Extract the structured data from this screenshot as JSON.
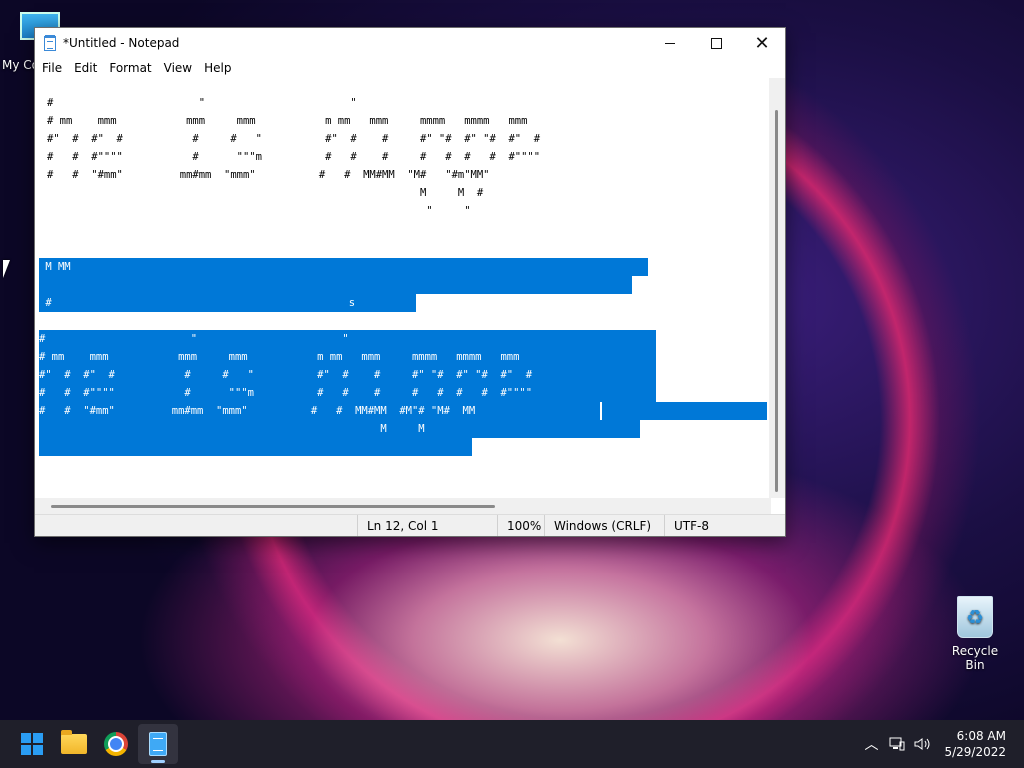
{
  "desktop": {
    "icons": [
      {
        "label": "My Co"
      },
      {
        "label": "Recycle Bin"
      }
    ]
  },
  "window": {
    "title": "*Untitled - Notepad",
    "menu": [
      "File",
      "Edit",
      "Format",
      "View",
      "Help"
    ],
    "text_top": "#                       \"                       \"\n# mm    mmm           mmm     mmm           m mm   mmm     mmmm   mmmm   mmm\n#\"  #  #\"  #           #     #   \"          #\"  #    #     #\" \"#  #\" \"#  #\"  #\n#   #  #\"\"\"\"           #      \"\"\"m          #   #    #     #   #  #   #  #\"\"\"\"\n#   #  \"#mm\"         mm#mm  \"mmm\"          #   #  MM#MM  \"M#   \"#m\"MM\"\n                                                           M     M  #\n                                                            \"     \"",
    "selected_lines": [
      " M MM",
      "",
      " #                                               s",
      "",
      "#                       \"                       \"",
      "# mm    mmm           mmm     mmm           m mm   mmm     mmmm   mmmm   mmm",
      "#\"  #  #\"  #           #     #   \"          #\"  #    #     #\" \"#  #\" \"#  #\"  #",
      "#   #  #\"\"\"\"           #      \"\"\"m          #   #    #     #   #  #   #  #\"\"\"\"",
      "#   #  \"#mm\"         mm#mm  \"mmm\"          #   #  MM#MM  #M\"# \"M#  MM",
      "                                                      M     M",
      "",
      ""
    ],
    "status": {
      "position": "Ln 12, Col 1",
      "zoom": "100%",
      "line_ending": "Windows (CRLF)",
      "encoding": "UTF-8"
    }
  },
  "taskbar": {
    "apps": [
      "start",
      "file-explorer",
      "chrome",
      "notepad"
    ],
    "time": "6:08 AM",
    "date": "5/29/2022"
  },
  "colors": {
    "selection": "#0078d7",
    "taskbar": "#1f1f2a"
  }
}
